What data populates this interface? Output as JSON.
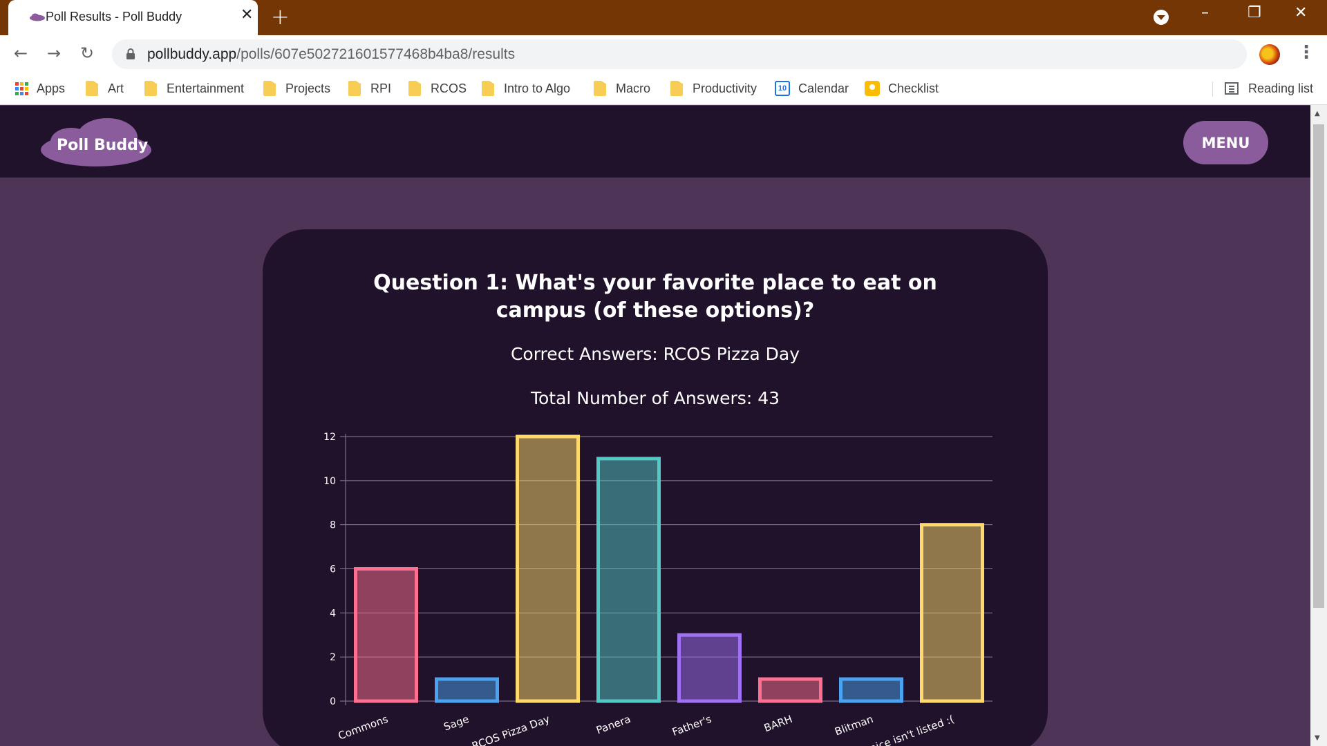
{
  "browser": {
    "tab_title": "Poll Results - Poll Buddy",
    "tab_close": "✕",
    "new_tab": "+",
    "window_controls": {
      "minimize": "–",
      "restore": "❐",
      "close": "✕"
    },
    "back_icon": "←",
    "forward_icon": "→",
    "reload_icon": "↻",
    "url_host": "pollbuddy.app",
    "url_path": "/polls/607e502721601577468b4ba8/results",
    "star_icon": "☆",
    "menu_icon": "⋮",
    "bookmarks": [
      {
        "label": "Apps",
        "icon": "apps-grid-icon"
      },
      {
        "label": "Art",
        "icon": "folder-icon"
      },
      {
        "label": "Entertainment",
        "icon": "folder-icon"
      },
      {
        "label": "Projects",
        "icon": "folder-icon"
      },
      {
        "label": "RPI",
        "icon": "folder-icon"
      },
      {
        "label": "RCOS",
        "icon": "folder-icon"
      },
      {
        "label": "Intro to Algo",
        "icon": "folder-icon"
      },
      {
        "label": "Macro",
        "icon": "folder-icon"
      },
      {
        "label": "Productivity",
        "icon": "folder-icon"
      },
      {
        "label": "Calendar",
        "icon": "calendar-icon"
      },
      {
        "label": "Checklist",
        "icon": "keep-icon"
      }
    ],
    "calendar_icon_text": "10",
    "reading_list": "Reading list",
    "colors": {
      "tabbar": "#733604"
    }
  },
  "site": {
    "logo": "Poll Buddy",
    "menu_label": "MENU",
    "colors": {
      "header": "#21122b",
      "background": "#4e3558",
      "card": "#21122b",
      "accent": "#8a5c9c"
    }
  },
  "results": {
    "question": "Question 1: What's your favorite place to eat on campus (of these options)?",
    "correct_answers": "Correct Answers: RCOS Pizza Day",
    "total_answers": "Total Number of Answers: 43"
  },
  "chart_data": {
    "type": "bar",
    "categories": [
      "Commons",
      "Sage",
      "RCOS Pizza Day",
      "Panera",
      "Father's",
      "BARH",
      "Blitman",
      "My choice isn't listed :("
    ],
    "values": [
      6,
      1,
      12,
      11,
      3,
      1,
      1,
      8
    ],
    "colors": [
      "#ff6f91",
      "#4aa3f0",
      "#ffd96b",
      "#52c9c5",
      "#a070f5",
      "#ff6f91",
      "#4aa3f0",
      "#ffd96b"
    ],
    "ylim": [
      0,
      12
    ],
    "yticks": [
      0,
      2,
      4,
      6,
      8,
      10,
      12
    ],
    "grid": true,
    "legend": false
  }
}
